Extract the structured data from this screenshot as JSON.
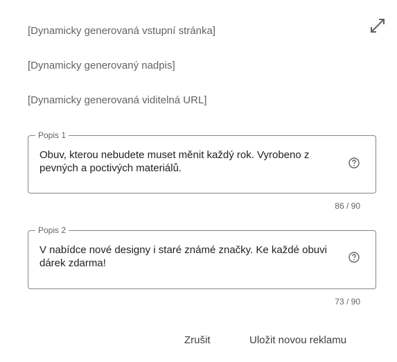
{
  "preview": {
    "landing_page": "[Dynamicky generovaná vstupní stránka]",
    "headline": "[Dynamicky generovaný nadpis]",
    "display_url": "[Dynamicky generovaná viditelná URL]",
    "expand_icon": "expand-diagonal-icon"
  },
  "fields": [
    {
      "label": "Popis 1",
      "value": "Obuv, kterou nebudete muset měnit každý rok. Vyrobeno z pevných a poctivých materiálů.",
      "counter": "86 / 90",
      "help_icon": "help-circle-icon"
    },
    {
      "label": "Popis 2",
      "value": "V nabídce nové designy i staré známé značky. Ke každé obuvi dárek zdarma!",
      "counter": "73 / 90",
      "help_icon": "help-circle-icon"
    }
  ],
  "actions": {
    "cancel_label": "Zrušit",
    "save_label": "Uložit novou reklamu"
  }
}
